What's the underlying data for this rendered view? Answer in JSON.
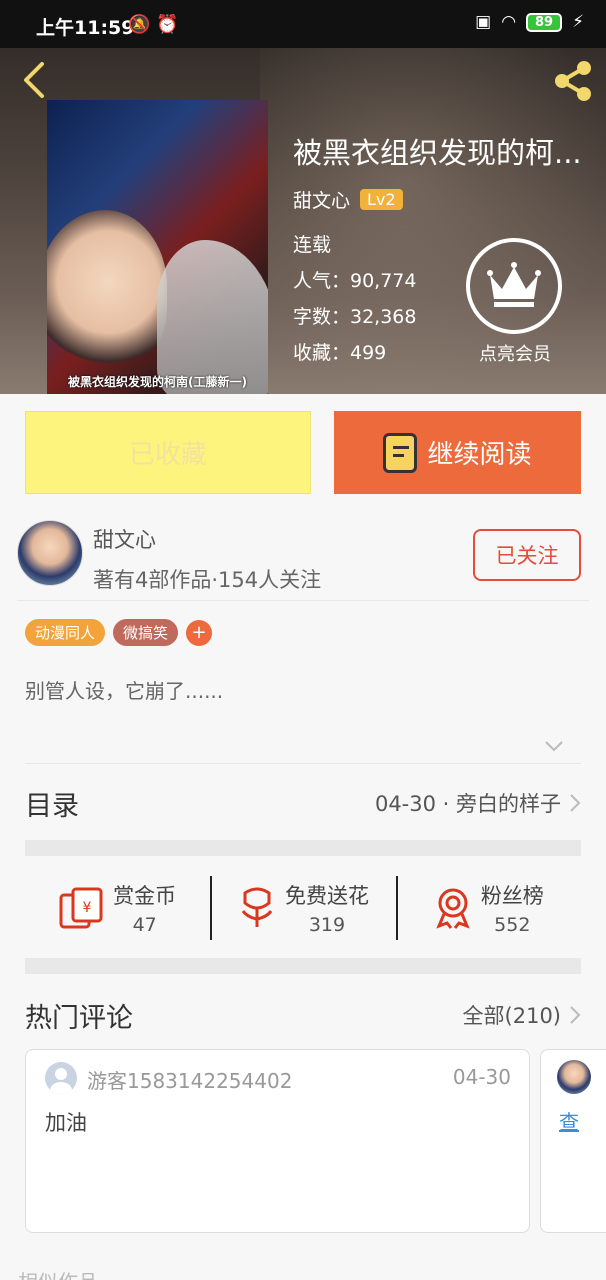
{
  "status_bar": {
    "time": "上午11:59",
    "battery": "89"
  },
  "book": {
    "title": "被黑衣组织发现的柯...",
    "cover_caption": "被黑衣组织发现的柯南(工藤新一)",
    "author": "甜文心",
    "level": "Lv2",
    "status": "连载",
    "popularity": "人气：90,774",
    "word_count": "字数：32,368",
    "favorites": "收藏：499",
    "vip_label": "点亮会员"
  },
  "actions": {
    "favorited_label": "已收藏",
    "continue_label": "继续阅读"
  },
  "author_card": {
    "name": "甜文心",
    "stats": "著有4部作品·154人关注",
    "follow_label": "已关注"
  },
  "tags": [
    {
      "label": "动漫同人",
      "color": "#f2a33a"
    },
    {
      "label": "微搞笑",
      "color": "#c06a5e"
    }
  ],
  "tag_add": "+",
  "intro": "别管人设，它崩了......",
  "toc": {
    "title": "目录",
    "latest": "04-30 · 旁白的样子"
  },
  "stats": [
    {
      "label": "赏金币",
      "value": "47",
      "icon": "red-envelope-icon"
    },
    {
      "label": "免费送花",
      "value": "319",
      "icon": "flower-icon"
    },
    {
      "label": "粉丝榜",
      "value": "552",
      "icon": "medal-icon"
    }
  ],
  "hot_comments": {
    "title": "热门评论",
    "all_label": "全部(210)",
    "items": [
      {
        "user": "游客1583142254402",
        "date": "04-30",
        "text": "加油"
      }
    ],
    "peek_link": "查"
  },
  "bottom_peek": "相似作品",
  "colors": {
    "accent": "#ec6a3c",
    "favorited_bg": "#fdf47e",
    "follow": "#e34d3a"
  }
}
